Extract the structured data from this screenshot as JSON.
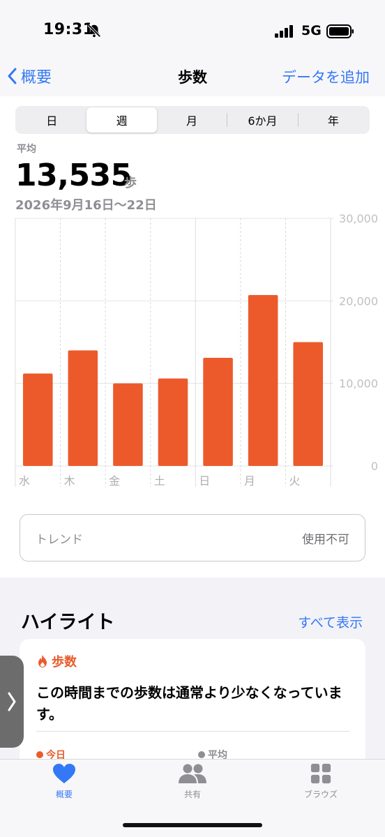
{
  "status_bar": {
    "time": "19:31",
    "network": "5G"
  },
  "nav": {
    "back_label": "概要",
    "title": "歩数",
    "add_label": "データを追加"
  },
  "segments": [
    {
      "label": "日",
      "selected": false
    },
    {
      "label": "週",
      "selected": true
    },
    {
      "label": "月",
      "selected": false
    },
    {
      "label": "6か月",
      "selected": false
    },
    {
      "label": "年",
      "selected": false
    }
  ],
  "summary": {
    "avg_label": "平均",
    "avg_value": "13,535",
    "unit": "歩",
    "date_range": "2026年9月16日〜22日"
  },
  "chart_data": {
    "type": "bar",
    "categories": [
      "水",
      "木",
      "金",
      "土",
      "日",
      "月",
      "火"
    ],
    "values": [
      11200,
      14000,
      10000,
      10600,
      13100,
      20700,
      15000
    ],
    "ylim": [
      0,
      30000
    ],
    "yticks": [
      "0",
      "10,000",
      "20,000",
      "30,000"
    ],
    "grid": true,
    "bar_color": "#ec5a2b"
  },
  "trend": {
    "label": "トレンド",
    "status": "使用不可"
  },
  "highlights": {
    "title": "ハイライト",
    "show_all": "すべて表示",
    "category": "歩数",
    "text": "この時間までの歩数は通常より少なくなっています。",
    "today_label": "今日",
    "avg_label": "平均"
  },
  "tabs": [
    {
      "label": "概要",
      "icon": "heart-icon",
      "active": true
    },
    {
      "label": "共有",
      "icon": "people-icon",
      "active": false
    },
    {
      "label": "ブラウズ",
      "icon": "grid-icon",
      "active": false
    }
  ],
  "colors": {
    "accent": "#3478f6",
    "steps": "#ec5a2b"
  }
}
